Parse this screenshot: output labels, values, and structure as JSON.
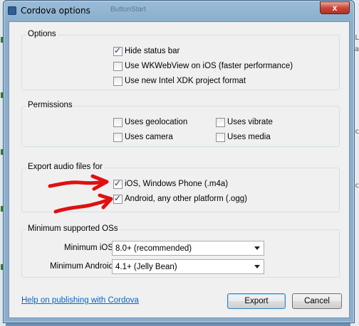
{
  "window": {
    "title": "Cordova options",
    "ghost_text": "ButtonStart",
    "close_glyph": "x"
  },
  "options": {
    "title": "Options",
    "items": [
      {
        "label": "Hide status bar",
        "checked": true
      },
      {
        "label": "Use WKWebView on iOS (faster performance)",
        "checked": false
      },
      {
        "label": "Use new Intel XDK project format",
        "checked": false
      }
    ]
  },
  "permissions": {
    "title": "Permissions",
    "items": [
      {
        "label": "Uses geolocation",
        "checked": false
      },
      {
        "label": "Uses vibrate",
        "checked": false
      },
      {
        "label": "Uses camera",
        "checked": false
      },
      {
        "label": "Uses media",
        "checked": false
      }
    ]
  },
  "audio": {
    "title": "Export audio files for",
    "items": [
      {
        "label": "iOS, Windows Phone (.m4a)",
        "checked": true
      },
      {
        "label": "Android, any other platform (.ogg)",
        "checked": true
      }
    ]
  },
  "min_os": {
    "title": "Minimum supported OSs",
    "ios_label": "Minimum iOS",
    "ios_value": "8.0+ (recommended)",
    "android_label": "Minimum Android",
    "android_value": "4.1+ (Jelly Bean)"
  },
  "footer": {
    "help_link": "Help on publishing with Cordova",
    "export_label": "Export",
    "cancel_label": "Cancel"
  },
  "background": {
    "right_chars": [
      "L",
      "ia",
      "ac",
      "ac"
    ]
  },
  "colors": {
    "annotation_red": "#e01010",
    "link_blue": "#0066cc",
    "close_red": "#c9473a"
  }
}
